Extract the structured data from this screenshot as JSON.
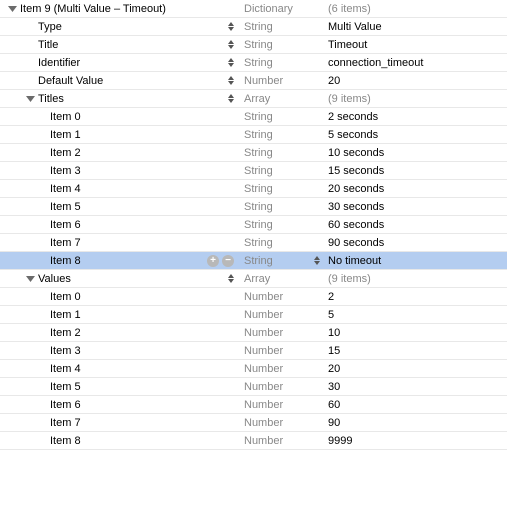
{
  "root": {
    "key": "Item 9 (Multi Value – Timeout)",
    "type": "Dictionary",
    "value": "(6 items)",
    "dim": true,
    "indent": 8,
    "disclosure": "open",
    "stepper_key": false
  },
  "props": [
    {
      "key": "Type",
      "type": "String",
      "value": "Multi Value",
      "indent": 38,
      "stepper_key": true,
      "stepper_type": false
    },
    {
      "key": "Title",
      "type": "String",
      "value": "Timeout",
      "indent": 38,
      "stepper_key": true,
      "stepper_type": false
    },
    {
      "key": "Identifier",
      "type": "String",
      "value": "connection_timeout",
      "indent": 38,
      "stepper_key": true,
      "stepper_type": false
    },
    {
      "key": "Default Value",
      "type": "Number",
      "value": "20",
      "indent": 38,
      "stepper_key": true,
      "stepper_type": false
    }
  ],
  "titles_header": {
    "key": "Titles",
    "type": "Array",
    "value": "(9 items)",
    "dim": true,
    "indent": 26,
    "disclosure": "open",
    "stepper_key": true
  },
  "titles": [
    {
      "key": "Item 0",
      "type": "String",
      "value": "2 seconds",
      "indent": 50
    },
    {
      "key": "Item 1",
      "type": "String",
      "value": "5 seconds",
      "indent": 50
    },
    {
      "key": "Item 2",
      "type": "String",
      "value": "10 seconds",
      "indent": 50
    },
    {
      "key": "Item 3",
      "type": "String",
      "value": "15 seconds",
      "indent": 50
    },
    {
      "key": "Item 4",
      "type": "String",
      "value": "20 seconds",
      "indent": 50
    },
    {
      "key": "Item 5",
      "type": "String",
      "value": "30 seconds",
      "indent": 50
    },
    {
      "key": "Item 6",
      "type": "String",
      "value": "60 seconds",
      "indent": 50
    },
    {
      "key": "Item 7",
      "type": "String",
      "value": "90 seconds",
      "indent": 50
    },
    {
      "key": "Item 8",
      "type": "String",
      "value": "No timeout",
      "indent": 50,
      "selected": true,
      "addrem": true,
      "stepper_type": true
    }
  ],
  "values_header": {
    "key": "Values",
    "type": "Array",
    "value": "(9 items)",
    "dim": true,
    "indent": 26,
    "disclosure": "open",
    "stepper_key": true
  },
  "values": [
    {
      "key": "Item 0",
      "type": "Number",
      "value": "2",
      "indent": 50
    },
    {
      "key": "Item 1",
      "type": "Number",
      "value": "5",
      "indent": 50
    },
    {
      "key": "Item 2",
      "type": "Number",
      "value": "10",
      "indent": 50
    },
    {
      "key": "Item 3",
      "type": "Number",
      "value": "15",
      "indent": 50
    },
    {
      "key": "Item 4",
      "type": "Number",
      "value": "20",
      "indent": 50
    },
    {
      "key": "Item 5",
      "type": "Number",
      "value": "30",
      "indent": 50
    },
    {
      "key": "Item 6",
      "type": "Number",
      "value": "60",
      "indent": 50
    },
    {
      "key": "Item 7",
      "type": "Number",
      "value": "90",
      "indent": 50
    },
    {
      "key": "Item 8",
      "type": "Number",
      "value": "9999",
      "indent": 50
    }
  ]
}
